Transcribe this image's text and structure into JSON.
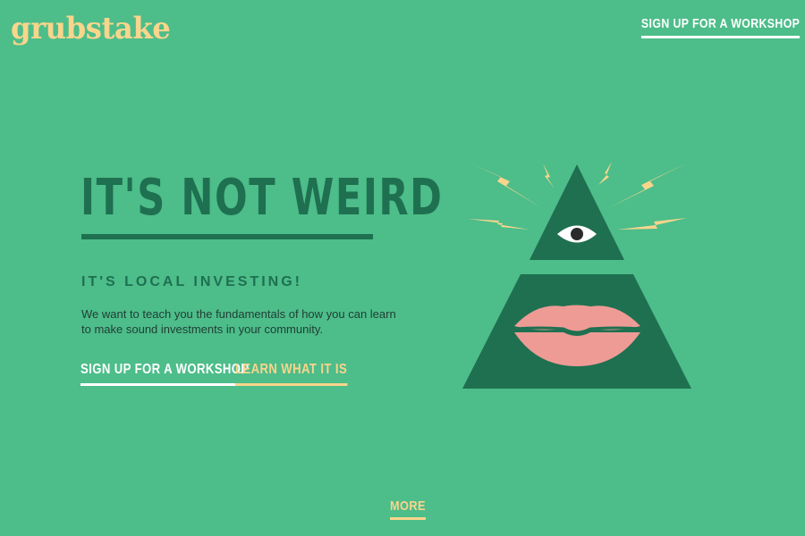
{
  "header": {
    "logo": "grubstake",
    "cta": "SIGN UP FOR A WORKSHOP"
  },
  "hero": {
    "title": "IT'S NOT WEIRD",
    "subtitle": "IT'S LOCAL INVESTING!",
    "description": "We want to teach you the fundamentals of how you can learn to make sound investments in your community.",
    "primary_cta": "SIGN UP FOR A WORKSHOP",
    "secondary_cta": "LEARN WHAT IT IS"
  },
  "footer": {
    "more": "MORE"
  },
  "illustration": {
    "icons": [
      "pyramid-icon",
      "eye-icon",
      "lips-icon",
      "lightning-bolt-icon"
    ]
  },
  "colors": {
    "background": "#4dbd8a",
    "dark_green": "#1e7050",
    "yellow": "#f9d58c",
    "white": "#ffffff",
    "pink": "#ee9b96"
  }
}
